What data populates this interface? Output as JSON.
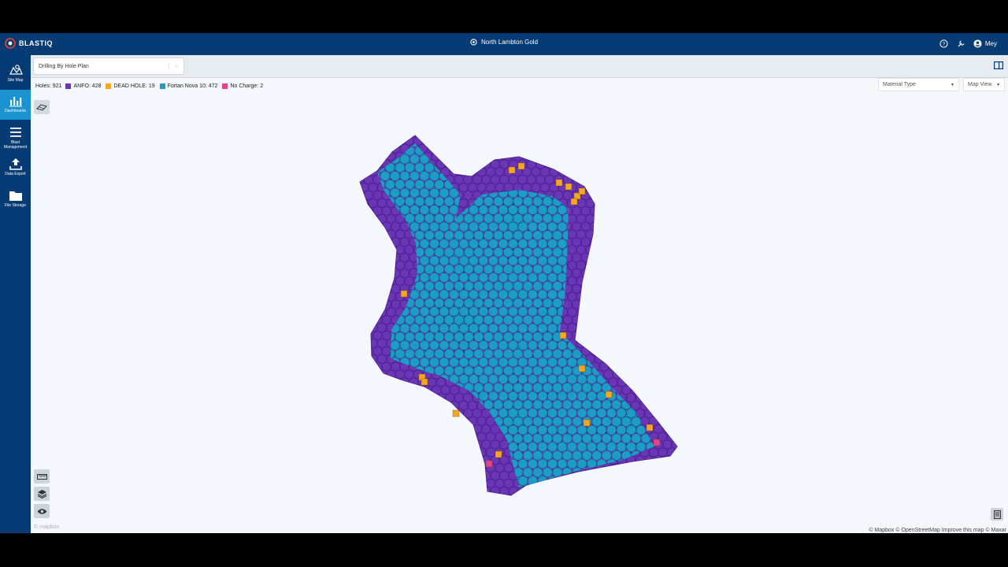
{
  "header": {
    "brand": "BLASTIQ",
    "site_name": "North Lambton Gold",
    "user": "Mey"
  },
  "sidebar": {
    "items": [
      {
        "label": "Site Map",
        "icon": "map-icon",
        "active": false
      },
      {
        "label": "Dashboards",
        "icon": "dashboard-icon",
        "active": true
      },
      {
        "label": "Blast Management",
        "icon": "list-icon",
        "active": false
      },
      {
        "label": "Data Export",
        "icon": "upload-icon",
        "active": false
      },
      {
        "label": "File Storage",
        "icon": "folder-icon",
        "active": false
      }
    ]
  },
  "toolbar": {
    "plan_select": "Drilling By Hole Plan"
  },
  "legend": {
    "holes_text": "Holes: 921",
    "entries": [
      {
        "label": "ANFO: 428",
        "color": "#6b35b8"
      },
      {
        "label": "DEAD HOLE: 19",
        "color": "#f5a623"
      },
      {
        "label": "Fortan Nova 10: 472",
        "color": "#1b9dc6"
      },
      {
        "label": "No Charge: 2",
        "color": "#e0428c"
      }
    ]
  },
  "controls": {
    "material_type": "Material Type",
    "map_view": "Map View"
  },
  "map": {
    "attribution": "© Mapbox © OpenStreetMap Improve this map © Maxar",
    "mapbox_logo": "© mapbox"
  },
  "colors": {
    "header_bg": "#073b73",
    "active_nav": "#1b93d1",
    "anfo": "#6b35b8",
    "fortan": "#1b9dc6",
    "dead": "#f5a623",
    "nocharge": "#e0428c"
  }
}
